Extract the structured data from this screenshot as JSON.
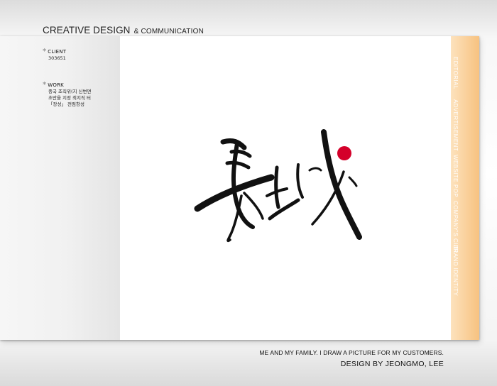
{
  "header": {
    "title_main": "CREATIVE DESIGN",
    "title_sub": "& COMMUNICATION"
  },
  "info": {
    "client_label": "CLIENT",
    "client_value": "303651",
    "work_label": "WORK",
    "work_lines": [
      "중국 조직위(지 신변면",
      "초반을 지정 최지직 터",
      "「장성」 전림창성"
    ]
  },
  "tabs": [
    "EDITORIAL",
    "ADVERTISEMENT",
    "WEBSITE",
    "POP",
    "COMPANY'S CI/BI",
    "BRAND IDENTITY"
  ],
  "footer": {
    "line1": "ME AND MY FAMILY. I DRAW A PICTURE FOR MY CUSTOMERS.",
    "line2": "DESIGN BY JEONGMO, LEE"
  },
  "colors": {
    "accent_red": "#d4002a",
    "tab_orange": "#f7c280"
  }
}
